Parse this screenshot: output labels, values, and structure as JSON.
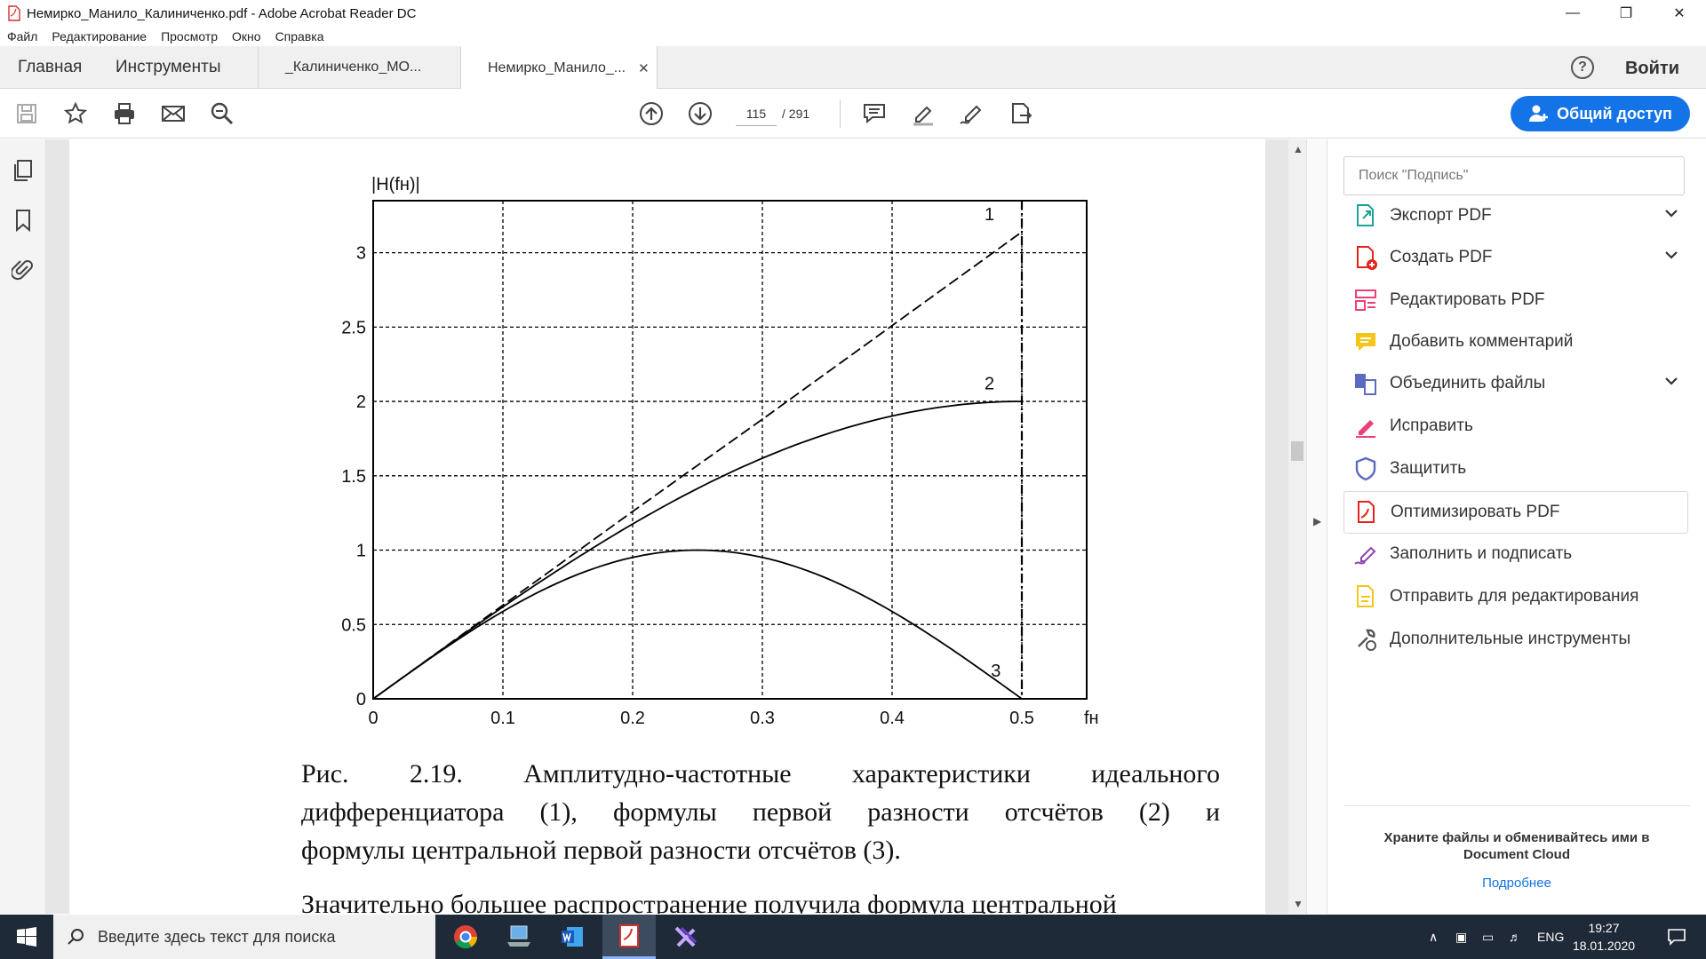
{
  "window": {
    "title": "Немирко_Манило_Калиниченко.pdf - Adobe Acrobat Reader DC"
  },
  "menu": [
    "Файл",
    "Редактирование",
    "Просмотр",
    "Окно",
    "Справка"
  ],
  "tabs": {
    "home": "Главная",
    "tools": "Инструменты",
    "doc1": "_Калиниченко_МО...",
    "doc2": "Немирко_Манило_..."
  },
  "header": {
    "login": "Войти",
    "help_icon": "help-icon"
  },
  "toolbar": {
    "page_current": "115",
    "page_total": "/  291",
    "share": "Общий доступ"
  },
  "chart_data": {
    "type": "line",
    "ylabel": "|H(fн)|",
    "xlabel": "fн",
    "xlim": [
      0,
      0.55
    ],
    "ylim": [
      0,
      3.35
    ],
    "xticks": [
      "0",
      "0.1",
      "0.2",
      "0.3",
      "0.4",
      "0.5"
    ],
    "yticks": [
      "0",
      "0.5",
      "1",
      "1.5",
      "2",
      "2.5",
      "3"
    ],
    "grid": true,
    "series": [
      {
        "name": "1",
        "style": "dashed",
        "x": [
          0,
          0.1,
          0.2,
          0.3,
          0.4,
          0.5
        ],
        "y": [
          0,
          0.63,
          1.26,
          1.88,
          2.51,
          3.14
        ]
      },
      {
        "name": "2",
        "style": "solid",
        "x": [
          0,
          0.05,
          0.1,
          0.15,
          0.2,
          0.25,
          0.3,
          0.35,
          0.4,
          0.45,
          0.5
        ],
        "y": [
          0,
          0.31,
          0.62,
          0.91,
          1.18,
          1.41,
          1.62,
          1.78,
          1.9,
          1.98,
          2.0
        ]
      },
      {
        "name": "3",
        "style": "solid",
        "x": [
          0,
          0.05,
          0.1,
          0.15,
          0.2,
          0.25,
          0.3,
          0.35,
          0.4,
          0.45,
          0.5
        ],
        "y": [
          0,
          0.31,
          0.59,
          0.81,
          0.95,
          1.0,
          0.95,
          0.81,
          0.59,
          0.31,
          0
        ]
      }
    ]
  },
  "document": {
    "caption_line1": "Рис.   2.19.   Амплитудно-частотные   характеристики   идеального",
    "caption_line2": "дифференциатора (1), формулы первой разности отсчётов (2) и",
    "caption_line3": "формулы центральной первой разности отсчётов (3).",
    "next_text": "Значительно большее распространение получила формула центральной"
  },
  "right_panel": {
    "search_placeholder": "Поиск \"Подпись\"",
    "tools": [
      {
        "label": "Экспорт PDF",
        "icon": "export-pdf-icon",
        "color": "#1aa39a"
      },
      {
        "label": "Создать PDF",
        "icon": "create-pdf-icon",
        "color": "#e1251b"
      },
      {
        "label": "Редактировать PDF",
        "icon": "edit-pdf-icon",
        "color": "#ec407a"
      },
      {
        "label": "Добавить комментарий",
        "icon": "comment-icon",
        "color": "#f5c518"
      },
      {
        "label": "Объединить файлы",
        "icon": "combine-files-icon",
        "color": "#5c6bc0"
      },
      {
        "label": "Исправить",
        "icon": "fix-icon",
        "color": "#ec407a"
      },
      {
        "label": "Защитить",
        "icon": "protect-icon",
        "color": "#5c6bc0"
      },
      {
        "label": "Оптимизировать PDF",
        "icon": "optimize-pdf-icon",
        "color": "#e1251b"
      },
      {
        "label": "Заполнить и подписать",
        "icon": "fill-sign-icon",
        "color": "#8e44ad"
      },
      {
        "label": "Отправить для редактирования",
        "icon": "send-review-icon",
        "color": "#f5c518"
      },
      {
        "label": "Дополнительные инструменты",
        "icon": "more-tools-icon",
        "color": "#555555"
      }
    ],
    "cloud_text": "Храните файлы и обменивайтесь ими в Document Cloud",
    "cloud_link": "Подробнее"
  },
  "taskbar": {
    "search_placeholder": "Введите здесь текст для поиска",
    "lang": "ENG",
    "time": "19:27",
    "date": "18.01.2020"
  }
}
